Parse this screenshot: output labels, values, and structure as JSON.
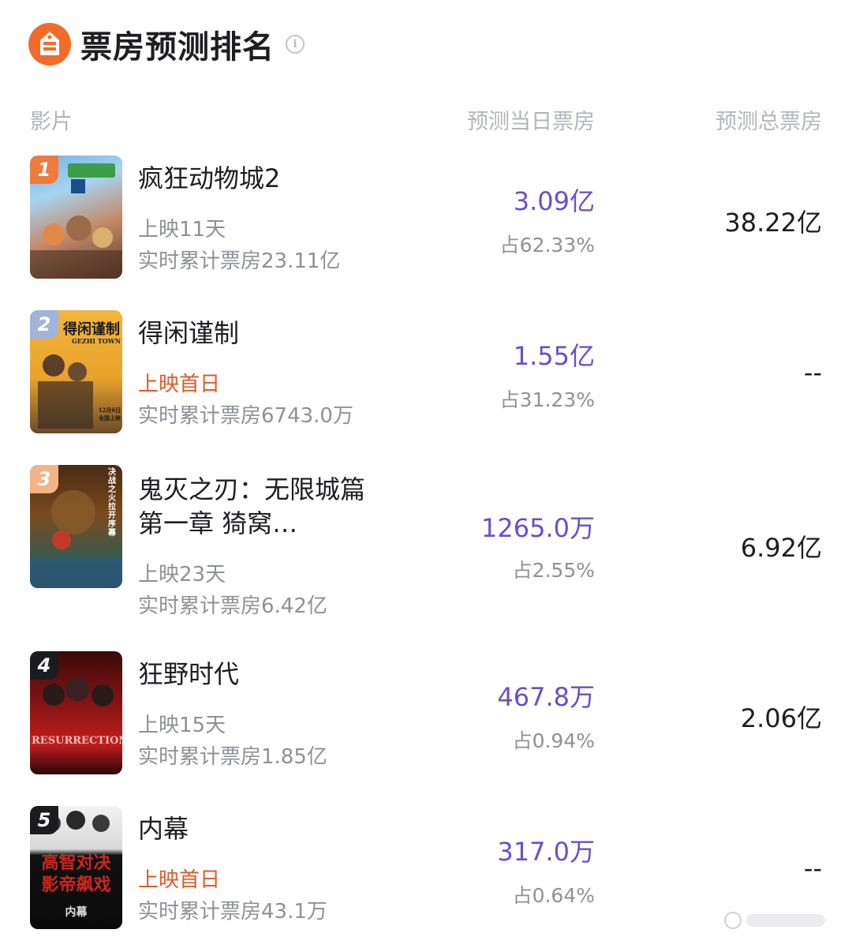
{
  "header": {
    "title": "票房预测排名",
    "info_icon": "info-icon",
    "logo_icon": "cinema-logo-icon"
  },
  "columns": {
    "film": "影片",
    "day_forecast": "预测当日票房",
    "total_forecast": "预测总票房"
  },
  "colors": {
    "accent_purple": "#6a4fc9",
    "first_day_orange": "#e05a2b",
    "rank1": "#f07a3c",
    "rank2": "#9fb4d8",
    "rank3": "#f3b384",
    "rank4": "#1c1c1e",
    "rank5": "#1c1c1e"
  },
  "films": [
    {
      "rank": "1",
      "name": "疯狂动物城2",
      "release": "上映11天",
      "cumulative": "实时累计票房23.11亿",
      "day_box": "3.09亿",
      "day_share": "占62.33%",
      "total_box": "38.22亿"
    },
    {
      "rank": "2",
      "name": "得闲谨制",
      "release": "上映首日",
      "cumulative": "实时累计票房6743.0万",
      "day_box": "1.55亿",
      "day_share": "占31.23%",
      "total_box": "--",
      "poster_title": "得闲谨制",
      "poster_subtitle": "GEZHI TOWN",
      "poster_date": "12月6日 全国上映"
    },
    {
      "rank": "3",
      "name": "鬼灭之刃：无限城篇 第一章 猗窝…",
      "release": "上映23天",
      "cumulative": "实时累计票房6.42亿",
      "day_box": "1265.0万",
      "day_share": "占2.55%",
      "total_box": "6.92亿",
      "poster_tagline": "决战之火 拉开序幕"
    },
    {
      "rank": "4",
      "name": "狂野时代",
      "release": "上映15天",
      "cumulative": "实时累计票房1.85亿",
      "day_box": "467.8万",
      "day_share": "占0.94%",
      "total_box": "2.06亿",
      "poster_title": "RESURRECTION"
    },
    {
      "rank": "5",
      "name": "内幕",
      "release": "上映首日",
      "cumulative": "实时累计票房43.1万",
      "day_box": "317.0万",
      "day_share": "占0.64%",
      "total_box": "--",
      "poster_line1": "高智对决",
      "poster_line2": "影帝飙戏",
      "poster_title": "内幕"
    }
  ]
}
